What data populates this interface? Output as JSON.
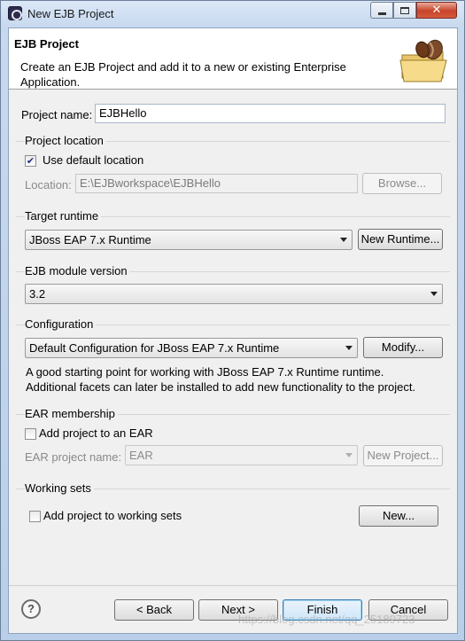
{
  "window": {
    "title": "New EJB Project"
  },
  "banner": {
    "title": "EJB Project",
    "description": "Create an EJB Project and add it to a new or existing Enterprise Application."
  },
  "project_name": {
    "label": "Project name:",
    "value": "EJBHello"
  },
  "project_location": {
    "title": "Project location",
    "use_default_label": "Use default location",
    "use_default_checked": true,
    "location_label": "Location:",
    "location_value": "E:\\EJBworkspace\\EJBHello",
    "browse_label": "Browse..."
  },
  "target_runtime": {
    "title": "Target runtime",
    "selected": "JBoss EAP 7.x Runtime",
    "new_runtime_label": "New Runtime..."
  },
  "ejb_module_version": {
    "title": "EJB module version",
    "selected": "3.2"
  },
  "configuration": {
    "title": "Configuration",
    "selected": "Default Configuration for JBoss EAP 7.x Runtime",
    "modify_label": "Modify...",
    "description_line1": "A good starting point for working with JBoss EAP 7.x Runtime runtime.",
    "description_line2": "Additional facets can later be installed to add new functionality to the project."
  },
  "ear_membership": {
    "title": "EAR membership",
    "add_to_ear_label": "Add project to an EAR",
    "add_to_ear_checked": false,
    "ear_project_name_label": "EAR project name:",
    "ear_project_name_value": "EAR",
    "new_project_label": "New Project..."
  },
  "working_sets": {
    "title": "Working sets",
    "add_label": "Add project to working sets",
    "add_checked": false,
    "new_label": "New..."
  },
  "footer": {
    "back_label": "< Back",
    "next_label": "Next >",
    "finish_label": "Finish",
    "cancel_label": "Cancel"
  },
  "watermark_text": "https://blog.csdn.net/qq_25189723",
  "icons": {
    "app": "eclipse-app-icon",
    "banner": "ejb-folder-bean-icon",
    "help": "help-icon"
  }
}
